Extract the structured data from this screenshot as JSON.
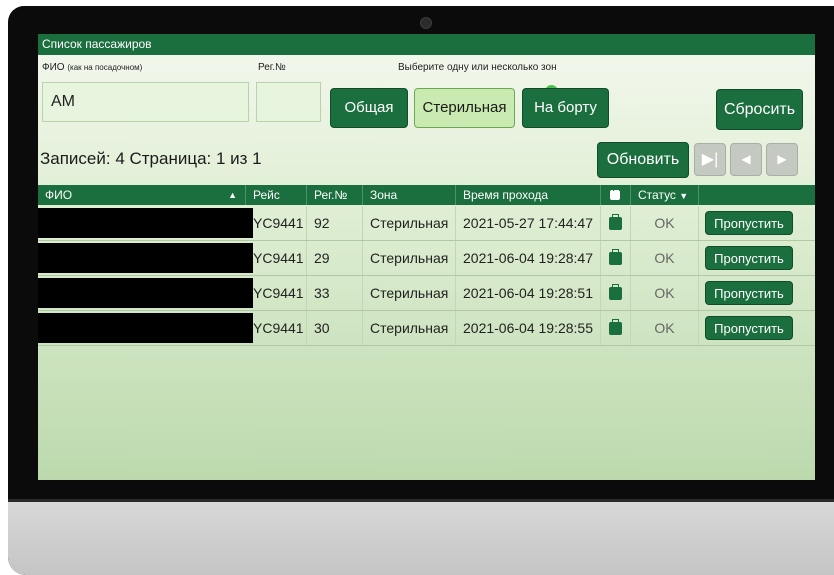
{
  "window": {
    "title": "Список пассажиров"
  },
  "filters": {
    "fio_label": "ФИО",
    "fio_sub": "(как на посадочном)",
    "fio_value": "АМ",
    "reg_label": "Рег.№",
    "reg_value": "",
    "zones_label": "Выберите одну или несколько зон"
  },
  "zones": [
    {
      "label": "Общая",
      "selected": false
    },
    {
      "label": "Стерильная",
      "selected": true
    },
    {
      "label": "На борту",
      "selected": false
    }
  ],
  "buttons": {
    "reset": "Сбросить",
    "refresh": "Обновить"
  },
  "records": "Записей: 4 Страница: 1 из 1",
  "table": {
    "headers": [
      "ФИО",
      "Рейс",
      "Рег.№",
      "Зона",
      "Время прохода",
      "Статус"
    ],
    "rows": [
      {
        "name": "",
        "flight": "YC9441",
        "reg": "92",
        "zone": "Стерильная",
        "time": "2021-05-27 17:44:47",
        "status": "OK",
        "action": "Пропустить"
      },
      {
        "name": "",
        "flight": "YC9441",
        "reg": "29",
        "zone": "Стерильная",
        "time": "2021-06-04 19:28:47",
        "status": "OK",
        "action": "Пропустить"
      },
      {
        "name": "",
        "flight": "YC9441",
        "reg": "33",
        "zone": "Стерильная",
        "time": "2021-06-04 19:28:51",
        "status": "OK",
        "action": "Пропустить"
      },
      {
        "name": "",
        "flight": "YC9441",
        "reg": "30",
        "zone": "Стерильная",
        "time": "2021-06-04 19:28:55",
        "status": "OK",
        "action": "Пропустить"
      }
    ]
  },
  "colors": {
    "accent": "#1b6e3e",
    "selected_zone": "#c9eab0",
    "check": "#46c24a"
  },
  "icons": {
    "baggage": "briefcase-icon",
    "sort_asc": "caret-up-icon",
    "sort_desc": "caret-down-icon",
    "check": "check-circle-icon",
    "first": "first-page-icon",
    "prev": "prev-page-icon",
    "next": "next-page-icon"
  }
}
